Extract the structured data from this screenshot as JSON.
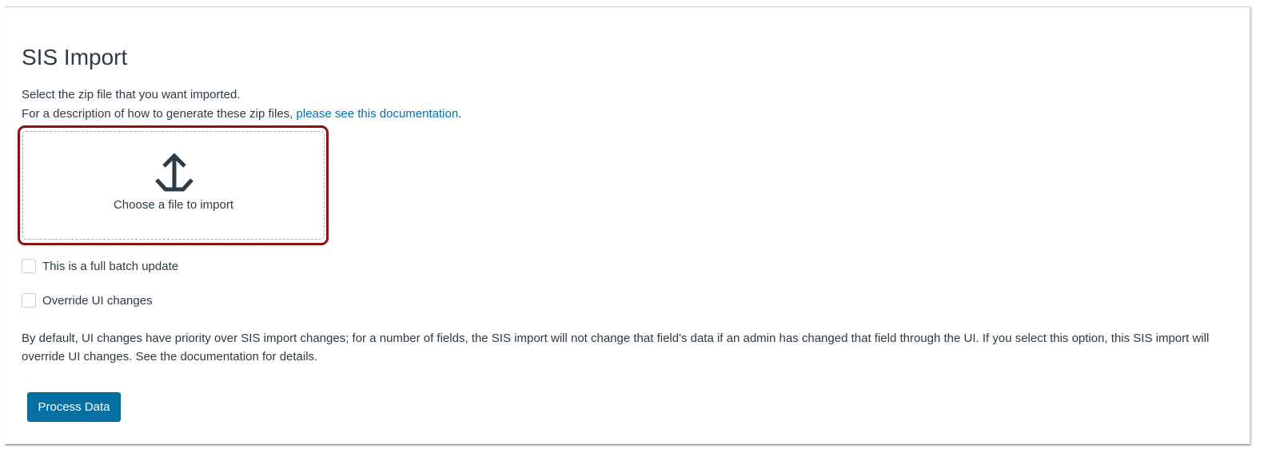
{
  "page": {
    "title": "SIS Import",
    "intro_line1": "Select the zip file that you want imported.",
    "intro_line2_prefix": "For a description of how to generate these zip files, ",
    "intro_link": "please see this documentation",
    "intro_line2_suffix": "."
  },
  "file_picker": {
    "icon": "upload-icon",
    "label": "Choose a file to import"
  },
  "options": [
    {
      "label": "This is a full batch update",
      "checked": false
    },
    {
      "label": "Override UI changes",
      "checked": false
    }
  ],
  "override_note": "By default, UI changes have priority over SIS import changes; for a number of fields, the SIS import will not change that field's data if an admin has changed that field through the UI. If you select this option, this SIS import will override UI changes. See the documentation for details.",
  "actions": {
    "process_label": "Process Data"
  },
  "colors": {
    "link": "#0770a3",
    "button": "#0770a3",
    "highlight": "#8b1010",
    "text": "#2d3b45"
  }
}
